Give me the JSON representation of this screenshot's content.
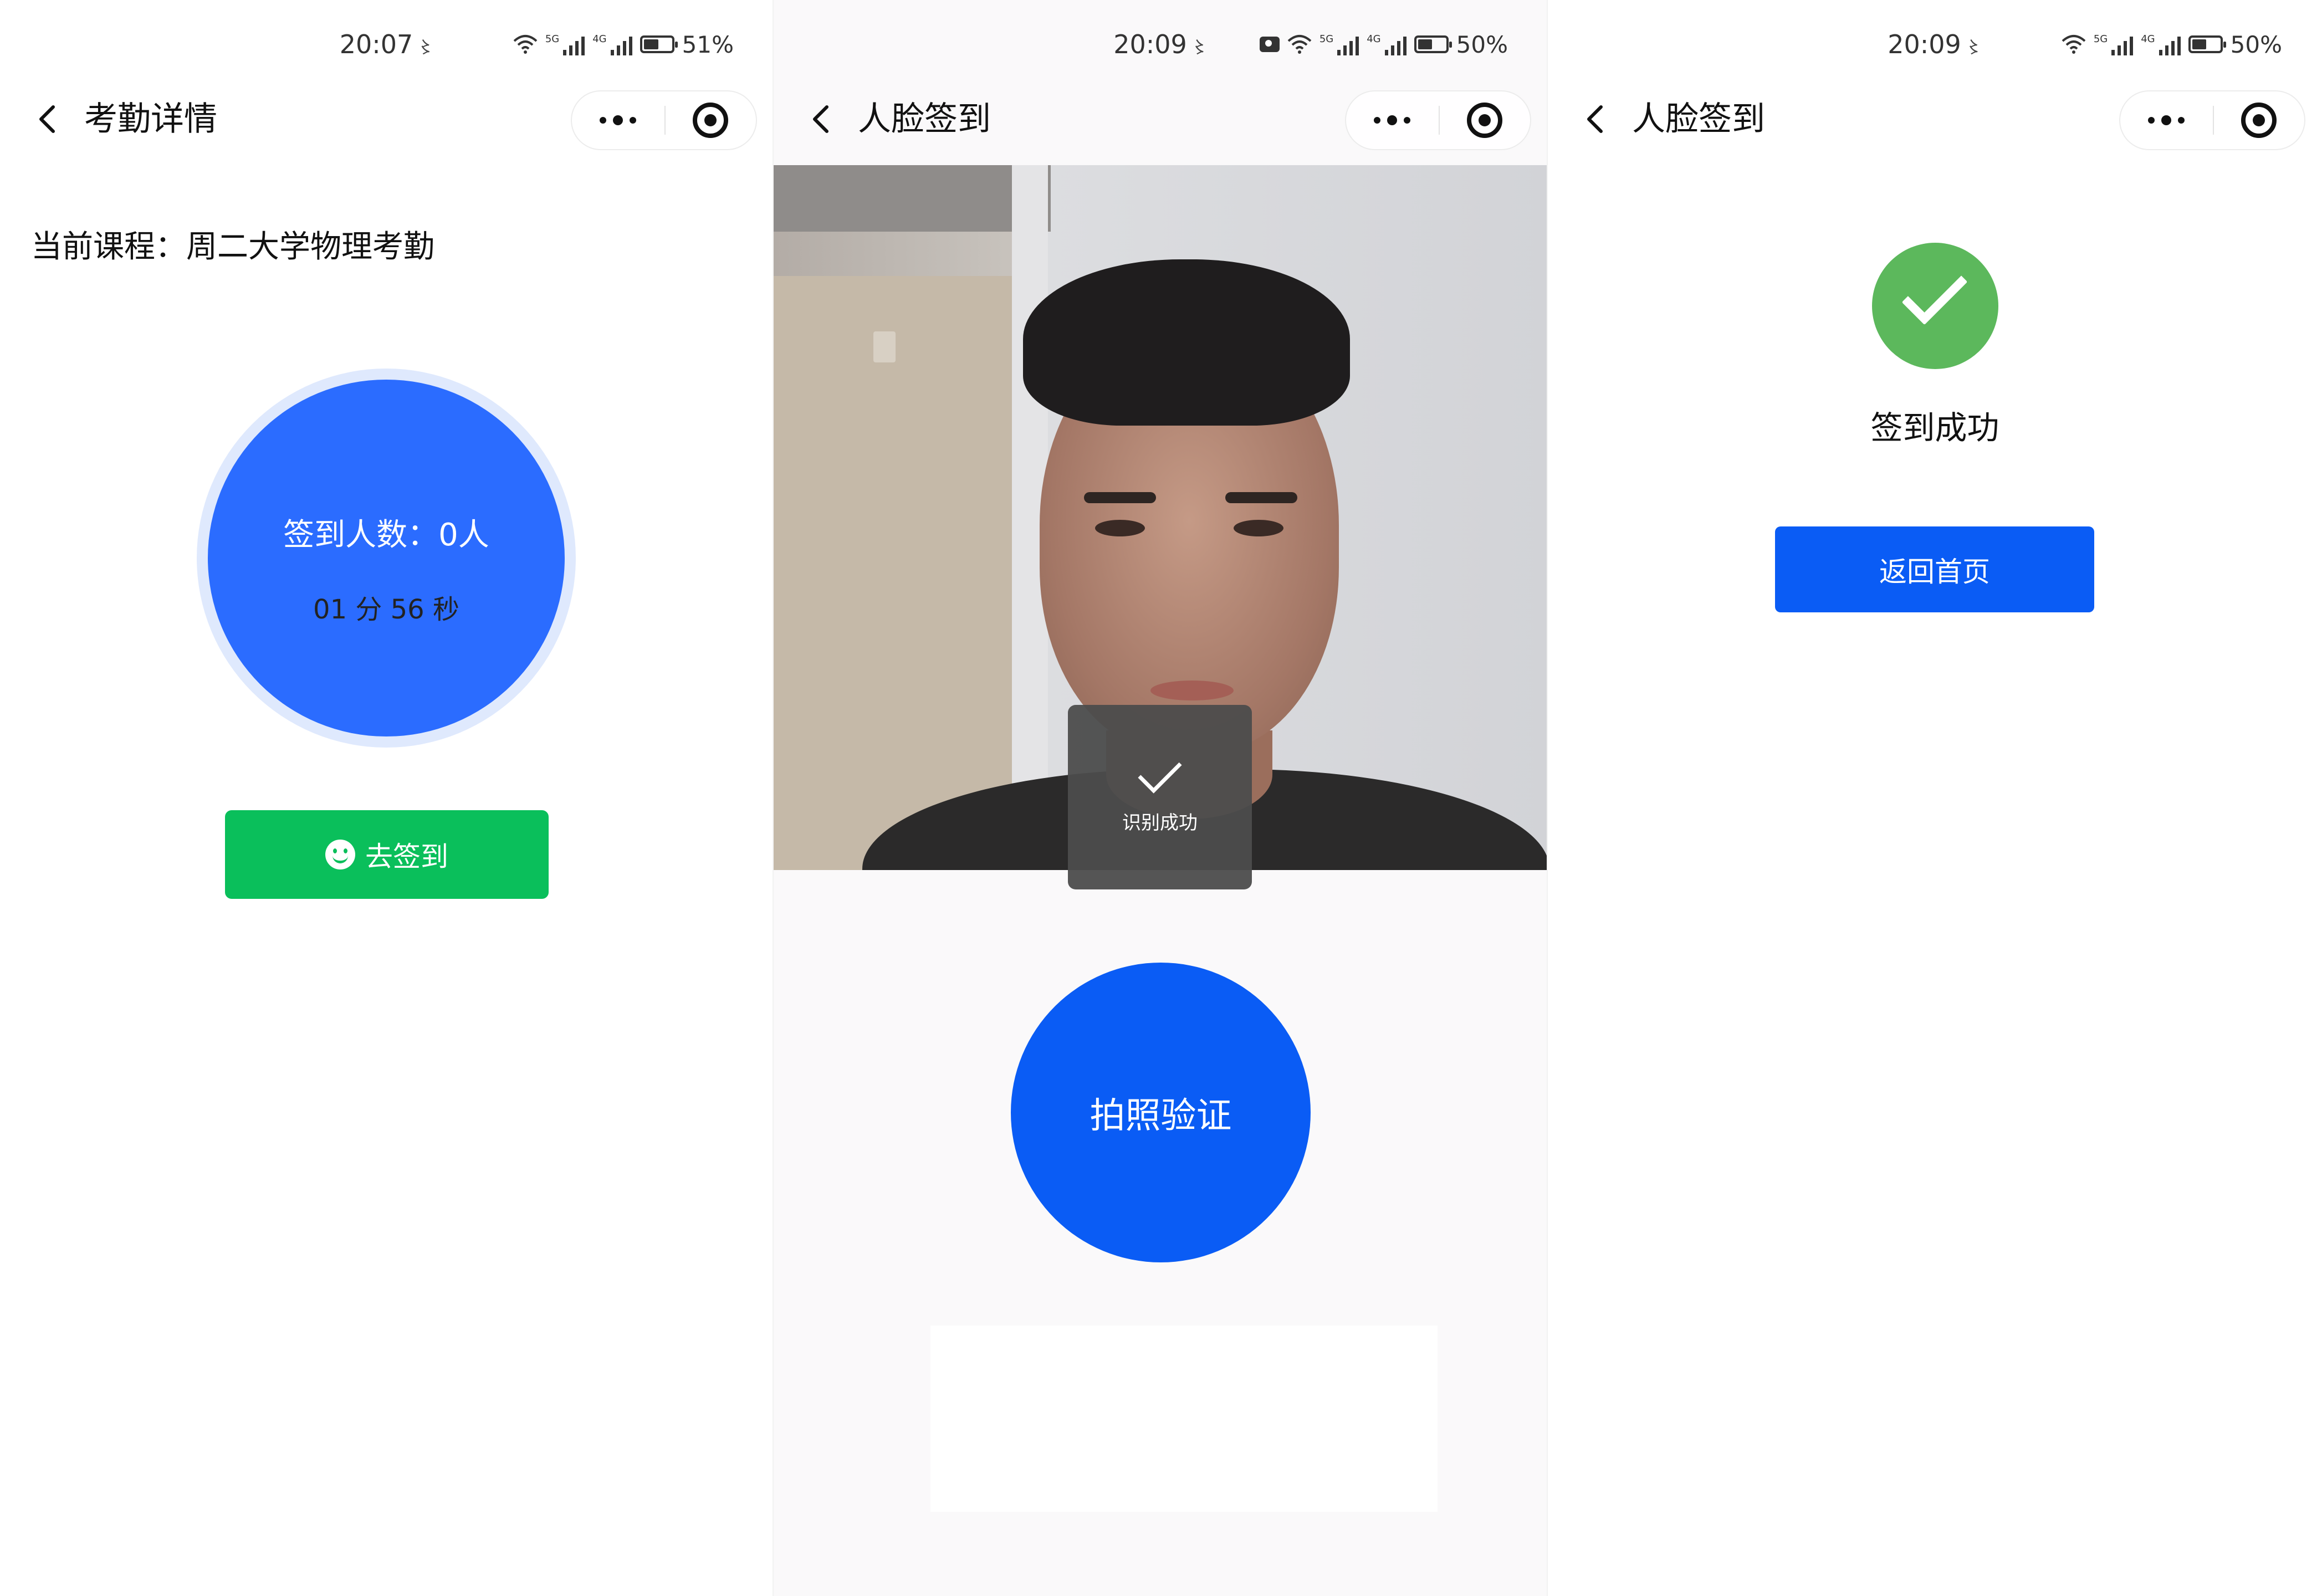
{
  "panels": [
    {
      "status": {
        "time": "20:07",
        "battery": "51%"
      },
      "nav": {
        "title": "考勤详情"
      },
      "course_label": "当前课程：周二大学物理考勤",
      "checkin": {
        "count_label": "签到人数：0人",
        "timer": "01 分 56 秒"
      },
      "action_button": "去签到"
    },
    {
      "status": {
        "time": "20:09",
        "battery": "50%"
      },
      "nav": {
        "title": "人脸签到"
      },
      "toast": "识别成功",
      "photo_button": "拍照验证"
    },
    {
      "status": {
        "time": "20:09",
        "battery": "50%"
      },
      "nav": {
        "title": "人脸签到"
      },
      "result": "签到成功",
      "home_button": "返回首页"
    }
  ],
  "colors": {
    "primary_blue": "#0a5cf5",
    "circle_blue": "#2b6cff",
    "green": "#0abf5b",
    "success_green": "#5cb85c"
  },
  "icons": [
    "back-icon",
    "more-icon",
    "close-mini-program-icon",
    "smile-icon",
    "check-icon",
    "wifi-icon",
    "signal-icon",
    "battery-icon",
    "camera-icon"
  ]
}
